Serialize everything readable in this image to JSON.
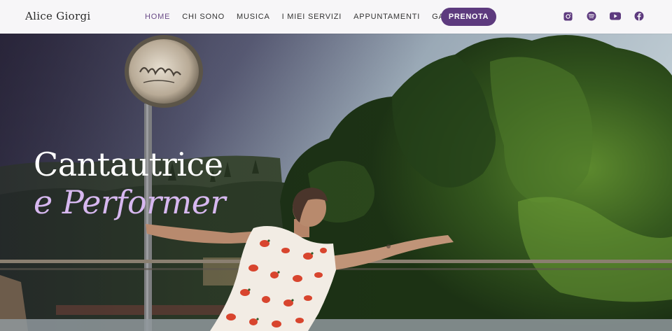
{
  "brand": {
    "name": "Alice Giorgi"
  },
  "nav": {
    "items": [
      {
        "label": "HOME",
        "active": true
      },
      {
        "label": "CHI SONO",
        "active": false
      },
      {
        "label": "MUSICA",
        "active": false
      },
      {
        "label": "I MIEI SERVIZI",
        "active": false
      },
      {
        "label": "APPUNTAMENTI",
        "active": false
      },
      {
        "label": "GALLERIA",
        "active": false
      }
    ],
    "cta_label": "PRENOTA"
  },
  "socials": [
    {
      "icon": "instagram-icon"
    },
    {
      "icon": "spotify-icon"
    },
    {
      "icon": "youtube-icon"
    },
    {
      "icon": "facebook-icon"
    }
  ],
  "hero": {
    "title_line1": "Cantautrice",
    "title_line2": "e Performer"
  },
  "colors": {
    "accent": "#5d3a7e",
    "nav_active": "#6a4b87",
    "title_italic": "#d7b8f0",
    "header_bg": "#f7f6f8"
  }
}
